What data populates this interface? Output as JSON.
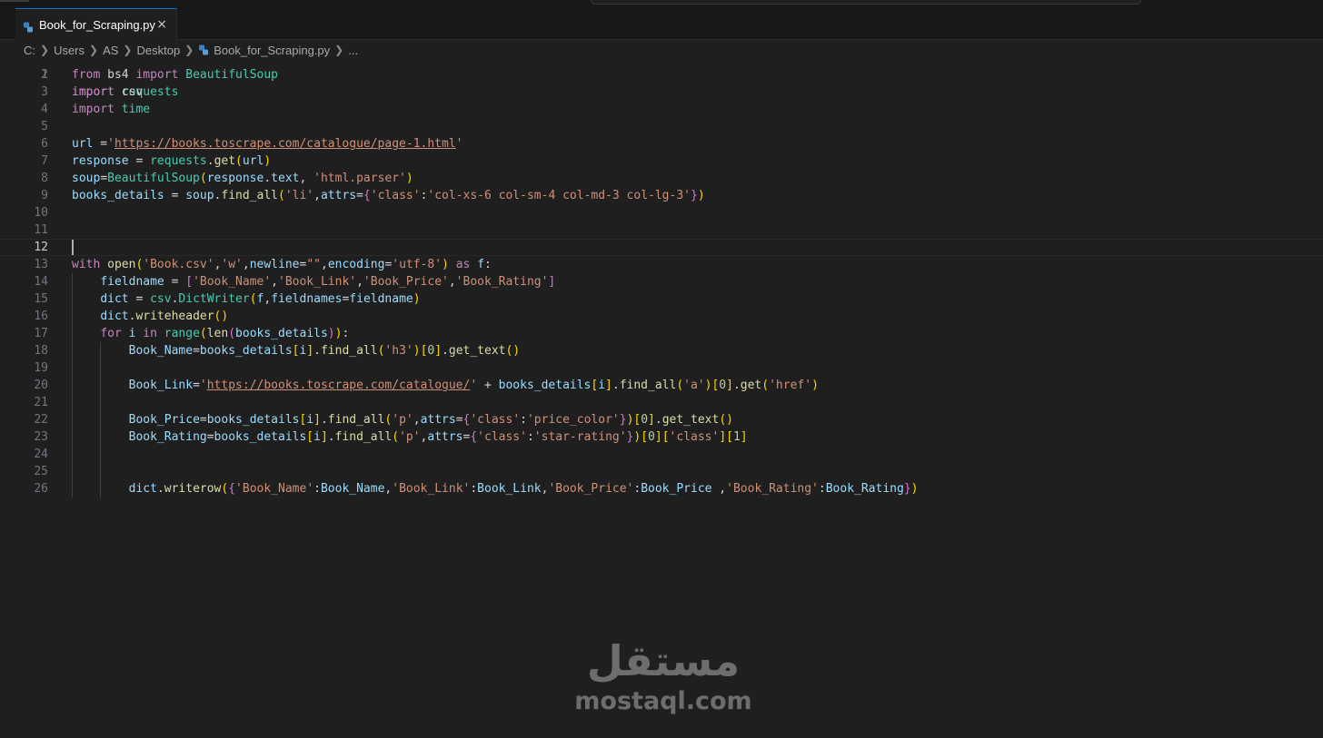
{
  "tab": {
    "filename": "Book_for_Scraping.py",
    "close_glyph": "×",
    "icon": "python-file-icon"
  },
  "breadcrumb": [
    "C:",
    "Users",
    "AS",
    "Desktop",
    "Book_for_Scraping.py",
    "..."
  ],
  "editor": {
    "active_line": 12,
    "partial_first_line": "import requests",
    "lines": [
      {
        "n": 2,
        "tokens": [
          [
            "kw",
            "from"
          ],
          [
            "op",
            " bs4 "
          ],
          [
            "kw",
            "import"
          ],
          [
            "op",
            " "
          ],
          [
            "cls",
            "BeautifulSoup"
          ]
        ]
      },
      {
        "n": 3,
        "tokens": [
          [
            "kw",
            "import"
          ],
          [
            "op",
            " csv"
          ]
        ]
      },
      {
        "n": 4,
        "tokens": [
          [
            "kw",
            "import"
          ],
          [
            "op",
            " "
          ],
          [
            "cls",
            "time"
          ]
        ]
      },
      {
        "n": 5,
        "tokens": []
      },
      {
        "n": 6,
        "tokens": [
          [
            "var",
            "url"
          ],
          [
            "op",
            " ="
          ],
          [
            "str",
            "'"
          ],
          [
            "url",
            "https://books.toscrape.com/catalogue/page-1.html"
          ],
          [
            "str",
            "'"
          ]
        ]
      },
      {
        "n": 7,
        "tokens": [
          [
            "var",
            "response"
          ],
          [
            "op",
            " = "
          ],
          [
            "cls",
            "requests"
          ],
          [
            "op",
            "."
          ],
          [
            "fn",
            "get"
          ],
          [
            "p1",
            "("
          ],
          [
            "var",
            "url"
          ],
          [
            "p1",
            ")"
          ]
        ]
      },
      {
        "n": 8,
        "tokens": [
          [
            "var",
            "soup"
          ],
          [
            "op",
            "="
          ],
          [
            "cls",
            "BeautifulSoup"
          ],
          [
            "p1",
            "("
          ],
          [
            "var",
            "response"
          ],
          [
            "op",
            "."
          ],
          [
            "var",
            "text"
          ],
          [
            "op",
            ", "
          ],
          [
            "str",
            "'html.parser'"
          ],
          [
            "p1",
            ")"
          ]
        ]
      },
      {
        "n": 9,
        "tokens": [
          [
            "var",
            "books_details"
          ],
          [
            "op",
            " = "
          ],
          [
            "var",
            "soup"
          ],
          [
            "op",
            "."
          ],
          [
            "fn",
            "find_all"
          ],
          [
            "p1",
            "("
          ],
          [
            "str",
            "'li'"
          ],
          [
            "op",
            ","
          ],
          [
            "var",
            "attrs"
          ],
          [
            "op",
            "="
          ],
          [
            "p2",
            "{"
          ],
          [
            "str",
            "'class'"
          ],
          [
            "op",
            ":"
          ],
          [
            "str",
            "'col-xs-6 col-sm-4 col-md-3 col-lg-3'"
          ],
          [
            "p2",
            "}"
          ],
          [
            "p1",
            ")"
          ]
        ]
      },
      {
        "n": 10,
        "tokens": []
      },
      {
        "n": 11,
        "tokens": []
      },
      {
        "n": 12,
        "tokens": []
      },
      {
        "n": 13,
        "tokens": [
          [
            "kw",
            "with"
          ],
          [
            "op",
            " "
          ],
          [
            "fn",
            "open"
          ],
          [
            "p1",
            "("
          ],
          [
            "str",
            "'Book.csv'"
          ],
          [
            "op",
            ","
          ],
          [
            "str",
            "'w'"
          ],
          [
            "op",
            ","
          ],
          [
            "var",
            "newline"
          ],
          [
            "op",
            "="
          ],
          [
            "str",
            "\"\""
          ],
          [
            "op",
            ","
          ],
          [
            "var",
            "encoding"
          ],
          [
            "op",
            "="
          ],
          [
            "str",
            "'utf-8'"
          ],
          [
            "p1",
            ")"
          ],
          [
            "op",
            " "
          ],
          [
            "kw",
            "as"
          ],
          [
            "op",
            " "
          ],
          [
            "var",
            "f"
          ],
          [
            "op",
            ":"
          ]
        ]
      },
      {
        "n": 14,
        "tokens": [
          [
            "op",
            "    "
          ],
          [
            "var",
            "fieldname"
          ],
          [
            "op",
            " = "
          ],
          [
            "p2",
            "["
          ],
          [
            "str",
            "'Book_Name'"
          ],
          [
            "op",
            ","
          ],
          [
            "str",
            "'Book_Link'"
          ],
          [
            "op",
            ","
          ],
          [
            "str",
            "'Book_Price'"
          ],
          [
            "op",
            ","
          ],
          [
            "str",
            "'Book_Rating'"
          ],
          [
            "p2",
            "]"
          ]
        ]
      },
      {
        "n": 15,
        "tokens": [
          [
            "op",
            "    "
          ],
          [
            "var",
            "dict"
          ],
          [
            "op",
            " = "
          ],
          [
            "cls",
            "csv"
          ],
          [
            "op",
            "."
          ],
          [
            "cls",
            "DictWriter"
          ],
          [
            "p1",
            "("
          ],
          [
            "var",
            "f"
          ],
          [
            "op",
            ","
          ],
          [
            "var",
            "fieldnames"
          ],
          [
            "op",
            "="
          ],
          [
            "var",
            "fieldname"
          ],
          [
            "p1",
            ")"
          ]
        ]
      },
      {
        "n": 16,
        "tokens": [
          [
            "op",
            "    "
          ],
          [
            "var",
            "dict"
          ],
          [
            "op",
            "."
          ],
          [
            "fn",
            "writeheader"
          ],
          [
            "p1",
            "()"
          ]
        ]
      },
      {
        "n": 17,
        "tokens": [
          [
            "op",
            "    "
          ],
          [
            "kw",
            "for"
          ],
          [
            "op",
            " "
          ],
          [
            "var",
            "i"
          ],
          [
            "op",
            " "
          ],
          [
            "kw",
            "in"
          ],
          [
            "op",
            " "
          ],
          [
            "cls",
            "range"
          ],
          [
            "p1",
            "("
          ],
          [
            "fn",
            "len"
          ],
          [
            "p2",
            "("
          ],
          [
            "var",
            "books_details"
          ],
          [
            "p2",
            ")"
          ],
          [
            "p1",
            ")"
          ],
          [
            "op",
            ":"
          ]
        ]
      },
      {
        "n": 18,
        "tokens": [
          [
            "op",
            "        "
          ],
          [
            "var",
            "Book_Name"
          ],
          [
            "op",
            "="
          ],
          [
            "var",
            "books_details"
          ],
          [
            "p1",
            "["
          ],
          [
            "var",
            "i"
          ],
          [
            "p1",
            "]"
          ],
          [
            "op",
            "."
          ],
          [
            "fn",
            "find_all"
          ],
          [
            "p1",
            "("
          ],
          [
            "str",
            "'h3'"
          ],
          [
            "p1",
            ")"
          ],
          [
            "p1",
            "["
          ],
          [
            "num",
            "0"
          ],
          [
            "p1",
            "]"
          ],
          [
            "op",
            "."
          ],
          [
            "fn",
            "get_text"
          ],
          [
            "p1",
            "()"
          ]
        ]
      },
      {
        "n": 19,
        "tokens": []
      },
      {
        "n": 20,
        "tokens": [
          [
            "op",
            "        "
          ],
          [
            "var",
            "Book_Link"
          ],
          [
            "op",
            "="
          ],
          [
            "str",
            "'"
          ],
          [
            "url",
            "https://books.toscrape.com/catalogue/"
          ],
          [
            "str",
            "'"
          ],
          [
            "op",
            " + "
          ],
          [
            "var",
            "books_details"
          ],
          [
            "p1",
            "["
          ],
          [
            "var",
            "i"
          ],
          [
            "p1",
            "]"
          ],
          [
            "op",
            "."
          ],
          [
            "fn",
            "find_all"
          ],
          [
            "p1",
            "("
          ],
          [
            "str",
            "'a'"
          ],
          [
            "p1",
            ")"
          ],
          [
            "p1",
            "["
          ],
          [
            "num",
            "0"
          ],
          [
            "p1",
            "]"
          ],
          [
            "op",
            "."
          ],
          [
            "fn",
            "get"
          ],
          [
            "p1",
            "("
          ],
          [
            "str",
            "'href'"
          ],
          [
            "p1",
            ")"
          ]
        ]
      },
      {
        "n": 21,
        "tokens": []
      },
      {
        "n": 22,
        "tokens": [
          [
            "op",
            "        "
          ],
          [
            "var",
            "Book_Price"
          ],
          [
            "op",
            "="
          ],
          [
            "var",
            "books_details"
          ],
          [
            "p1",
            "["
          ],
          [
            "var",
            "i"
          ],
          [
            "p1",
            "]"
          ],
          [
            "op",
            "."
          ],
          [
            "fn",
            "find_all"
          ],
          [
            "p1",
            "("
          ],
          [
            "str",
            "'p'"
          ],
          [
            "op",
            ","
          ],
          [
            "var",
            "attrs"
          ],
          [
            "op",
            "="
          ],
          [
            "p2",
            "{"
          ],
          [
            "str",
            "'class'"
          ],
          [
            "op",
            ":"
          ],
          [
            "str",
            "'price_color'"
          ],
          [
            "p2",
            "}"
          ],
          [
            "p1",
            ")"
          ],
          [
            "p1",
            "["
          ],
          [
            "num",
            "0"
          ],
          [
            "p1",
            "]"
          ],
          [
            "op",
            "."
          ],
          [
            "fn",
            "get_text"
          ],
          [
            "p1",
            "()"
          ]
        ]
      },
      {
        "n": 23,
        "tokens": [
          [
            "op",
            "        "
          ],
          [
            "var",
            "Book_Rating"
          ],
          [
            "op",
            "="
          ],
          [
            "var",
            "books_details"
          ],
          [
            "p1",
            "["
          ],
          [
            "var",
            "i"
          ],
          [
            "p1",
            "]"
          ],
          [
            "op",
            "."
          ],
          [
            "fn",
            "find_all"
          ],
          [
            "p1",
            "("
          ],
          [
            "str",
            "'p'"
          ],
          [
            "op",
            ","
          ],
          [
            "var",
            "attrs"
          ],
          [
            "op",
            "="
          ],
          [
            "p2",
            "{"
          ],
          [
            "str",
            "'class'"
          ],
          [
            "op",
            ":"
          ],
          [
            "str",
            "'star-rating'"
          ],
          [
            "p2",
            "}"
          ],
          [
            "p1",
            ")"
          ],
          [
            "p1",
            "["
          ],
          [
            "num",
            "0"
          ],
          [
            "p1",
            "]"
          ],
          [
            "p1",
            "["
          ],
          [
            "str",
            "'class'"
          ],
          [
            "p1",
            "]"
          ],
          [
            "p1",
            "["
          ],
          [
            "num",
            "1"
          ],
          [
            "p1",
            "]"
          ]
        ]
      },
      {
        "n": 24,
        "tokens": []
      },
      {
        "n": 25,
        "tokens": []
      },
      {
        "n": 26,
        "tokens": [
          [
            "op",
            "        "
          ],
          [
            "var",
            "dict"
          ],
          [
            "op",
            "."
          ],
          [
            "fn",
            "writerow"
          ],
          [
            "p1",
            "("
          ],
          [
            "p2",
            "{"
          ],
          [
            "str",
            "'Book_Name'"
          ],
          [
            "op",
            ":"
          ],
          [
            "var",
            "Book_Name"
          ],
          [
            "op",
            ","
          ],
          [
            "str",
            "'Book_Link'"
          ],
          [
            "op",
            ":"
          ],
          [
            "var",
            "Book_Link"
          ],
          [
            "op",
            ","
          ],
          [
            "str",
            "'Book_Price'"
          ],
          [
            "op",
            ":"
          ],
          [
            "var",
            "Book_Price"
          ],
          [
            "op",
            " ,"
          ],
          [
            "str",
            "'Book_Rating'"
          ],
          [
            "op",
            ":"
          ],
          [
            "var",
            "Book_Rating"
          ],
          [
            "p2",
            "}"
          ],
          [
            "p1",
            ")"
          ]
        ]
      }
    ]
  },
  "watermark": {
    "arabic": "مستقل",
    "latin": "mostaql.com"
  }
}
